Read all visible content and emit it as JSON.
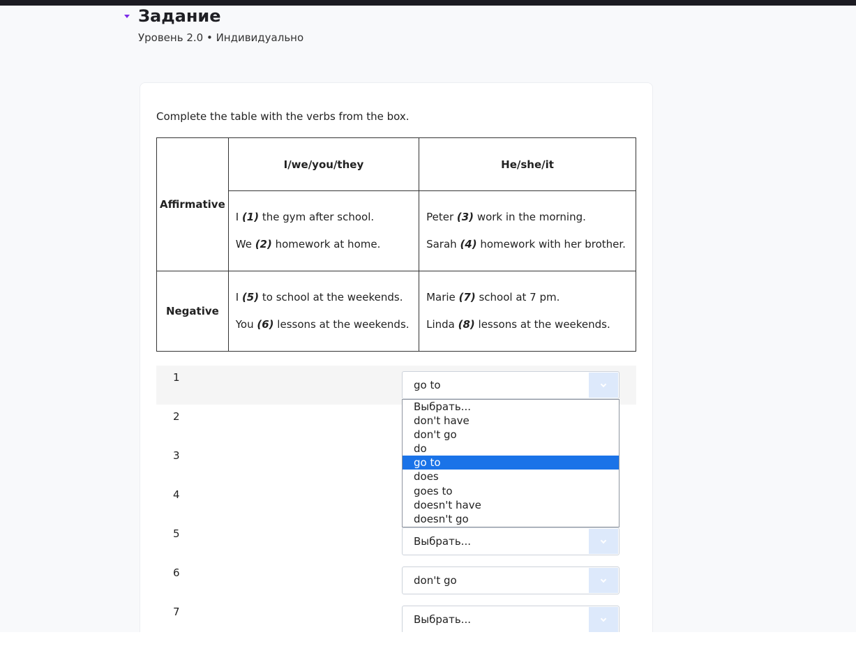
{
  "header": {
    "title": "Задание",
    "subtitle": "Уровень 2.0 • Индивидуально"
  },
  "task": {
    "instruction": "Complete the table with the verbs from the box.",
    "table": {
      "col_headers": [
        "I/we/you/they",
        "He/she/it"
      ],
      "rows": [
        {
          "label": "Affirmative",
          "cells": [
            [
              {
                "pre": "I ",
                "num": "(1)",
                "post": " the gym after school."
              },
              {
                "pre": "We ",
                "num": "(2)",
                "post": " homework at home."
              }
            ],
            [
              {
                "pre": "Peter ",
                "num": "(3)",
                "post": " work in the morning."
              },
              {
                "pre": "Sarah ",
                "num": "(4)",
                "post": " homework with her brother."
              }
            ]
          ]
        },
        {
          "label": "Negative",
          "cells": [
            [
              {
                "pre": "I ",
                "num": "(5)",
                "post": " to school at the weekends."
              },
              {
                "pre": "You ",
                "num": "(6)",
                "post": " lessons at the weekends."
              }
            ],
            [
              {
                "pre": "Marie ",
                "num": "(7)",
                "post": " school at 7 pm."
              },
              {
                "pre": "Linda ",
                "num": "(8)",
                "post": " lessons at the weekends."
              }
            ]
          ]
        }
      ]
    }
  },
  "answers": [
    {
      "number": "1",
      "value": "go to",
      "highlighted": true
    },
    {
      "number": "2",
      "value": ""
    },
    {
      "number": "3",
      "value": ""
    },
    {
      "number": "4",
      "value": ""
    },
    {
      "number": "5",
      "value": "Выбрать..."
    },
    {
      "number": "6",
      "value": "don't go"
    },
    {
      "number": "7",
      "value": "Выбрать..."
    }
  ],
  "dropdown": {
    "options": [
      "Выбрать...",
      "don't have",
      "don't go",
      "do",
      "go to",
      "does",
      "goes to",
      "doesn't have",
      "doesn't go"
    ],
    "selected": "go to"
  },
  "colors": {
    "accent": "#7c2ae8",
    "selected_option": "#1a73e8",
    "chevron_bg": "#dde9fb"
  }
}
